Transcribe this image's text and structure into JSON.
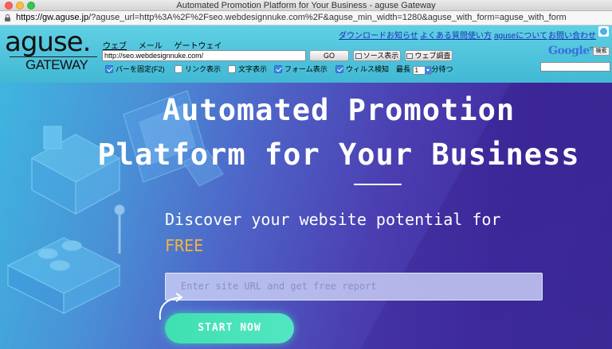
{
  "window": {
    "title": "Automated Promotion Platform for Your Business - aguse Gateway"
  },
  "address_bar": {
    "host": "https://gw.aguse.jp",
    "rest": "/?aguse_url=http%3A%2F%2Fseo.webdesignnuke.com%2F&aguse_min_width=1280&aguse_with_form=aguse_with_form"
  },
  "toolbar": {
    "logo_main": "aguse.",
    "logo_sub": "GATEWAY",
    "nav": [
      "ウェブ",
      "メール",
      "ゲートウェイ"
    ],
    "url_value": "http://seo.webdesignnuke.com/",
    "go_label": "GO",
    "source_label": "ソース表示",
    "survey_label": "ウェブ調査",
    "options": {
      "fix_bar": "バーを固定(F2)",
      "show_links": "リンク表示",
      "show_text": "文字表示",
      "show_forms": "フォーム表示",
      "virus_check": "ウィルス検知",
      "max_label": "最長",
      "max_value": "1",
      "wait_label": "分待つ"
    },
    "top_menu": [
      "ダウンロード",
      "お知らせ",
      "よくある質問",
      "使い方",
      "aguseについて",
      "お問い合わせ"
    ],
    "google_label": "Google",
    "google_tm": "TM",
    "google_search_btn": "検索"
  },
  "hero": {
    "headline_1": "Automated Promotion",
    "headline_2": "Platform for Your Business",
    "subheading": "Discover your website potential for",
    "free": "FREE",
    "input_placeholder": "Enter site URL and get free report",
    "cta": "START NOW"
  },
  "colors": {
    "toolbar_bg": "#4fc4dc",
    "link": "#1a2fb0",
    "free": "#f2b43b",
    "cta": "#46e3b8"
  }
}
